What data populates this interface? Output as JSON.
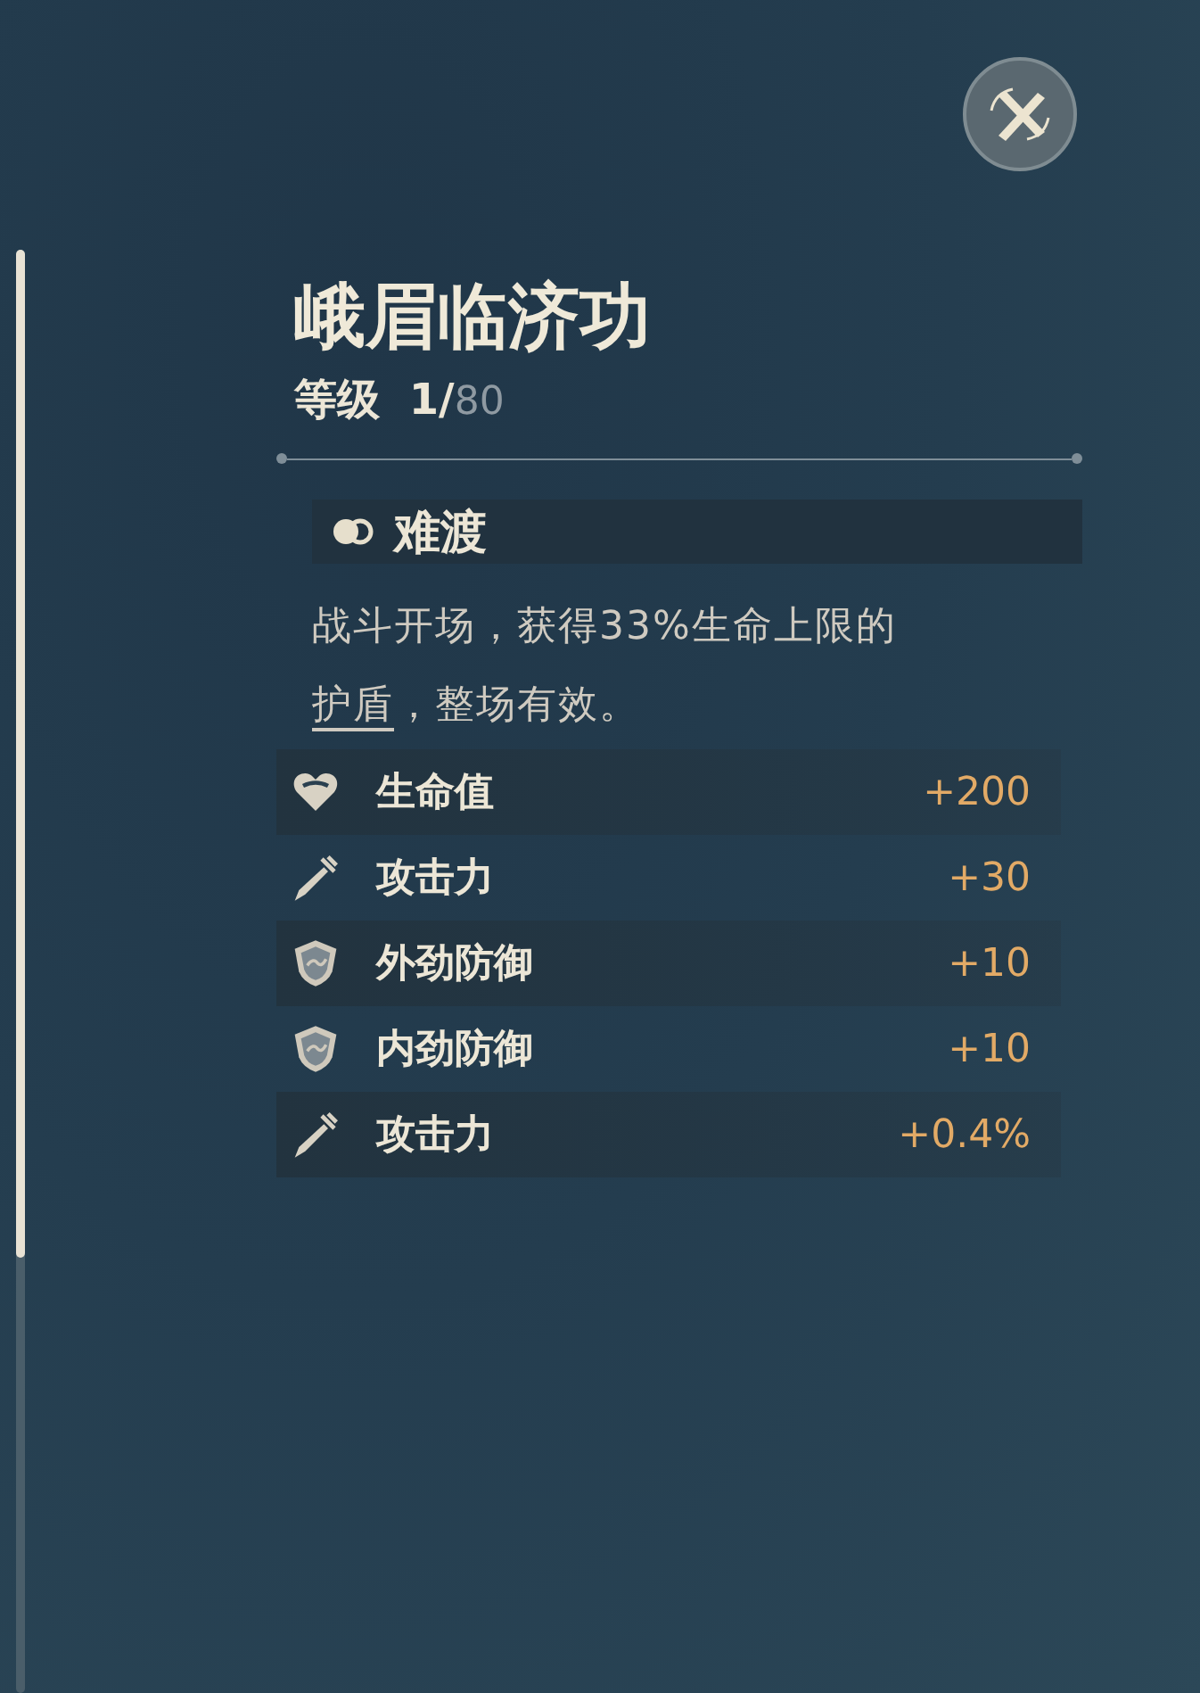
{
  "title": "峨眉临济功",
  "level": {
    "label": "等级",
    "current": "1/",
    "max": "80"
  },
  "skill": {
    "name": "难渡"
  },
  "description": [
    {
      "kind": "plain",
      "text": "战斗开场，获得33%生命上限的"
    },
    {
      "kind": "term",
      "text": "护盾"
    },
    {
      "kind": "plain",
      "text": "，整场有效。"
    }
  ],
  "stats": [
    {
      "kind": "heart",
      "name": "生命值",
      "value": "+200"
    },
    {
      "kind": "sword",
      "name": "攻击力",
      "value": "+30"
    },
    {
      "kind": "shield",
      "name": "外劲防御",
      "value": "+10"
    },
    {
      "kind": "shield",
      "name": "内劲防御",
      "value": "+10"
    },
    {
      "kind": "sword",
      "name": "攻击力",
      "value": "+0.4%"
    }
  ]
}
